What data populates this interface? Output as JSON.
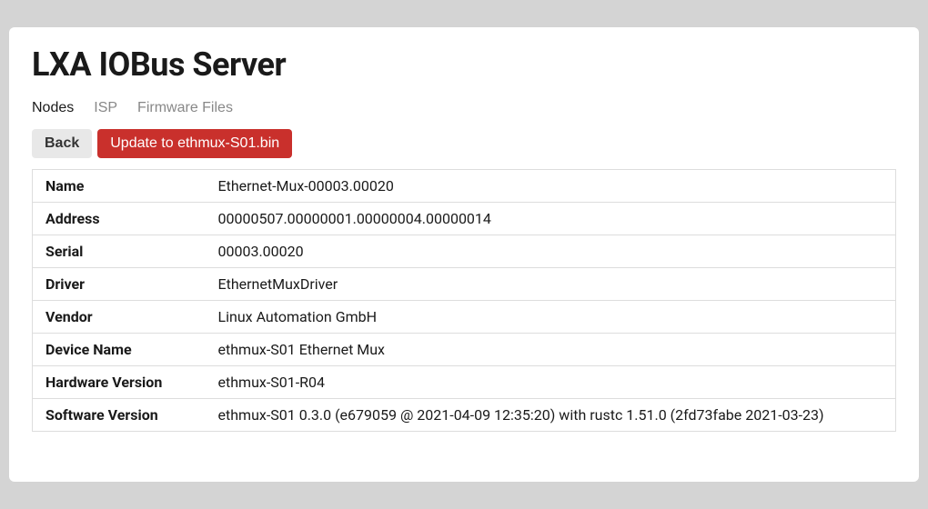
{
  "header": {
    "title": "LXA IOBus Server"
  },
  "tabs": [
    {
      "label": "Nodes",
      "active": true
    },
    {
      "label": "ISP",
      "active": false
    },
    {
      "label": "Firmware Files",
      "active": false
    }
  ],
  "toolbar": {
    "back_label": "Back",
    "update_label": "Update to ethmux-S01.bin"
  },
  "info": [
    {
      "label": "Name",
      "value": "Ethernet-Mux-00003.00020"
    },
    {
      "label": "Address",
      "value": "00000507.00000001.00000004.00000014"
    },
    {
      "label": "Serial",
      "value": "00003.00020"
    },
    {
      "label": "Driver",
      "value": "EthernetMuxDriver"
    },
    {
      "label": "Vendor",
      "value": "Linux Automation GmbH"
    },
    {
      "label": "Device Name",
      "value": "ethmux-S01 Ethernet Mux"
    },
    {
      "label": "Hardware Version",
      "value": "ethmux-S01-R04"
    },
    {
      "label": "Software Version",
      "value": "ethmux-S01 0.3.0 (e679059 @ 2021-04-09 12:35:20) with rustc 1.51.0 (2fd73fabe 2021-03-23)"
    }
  ]
}
